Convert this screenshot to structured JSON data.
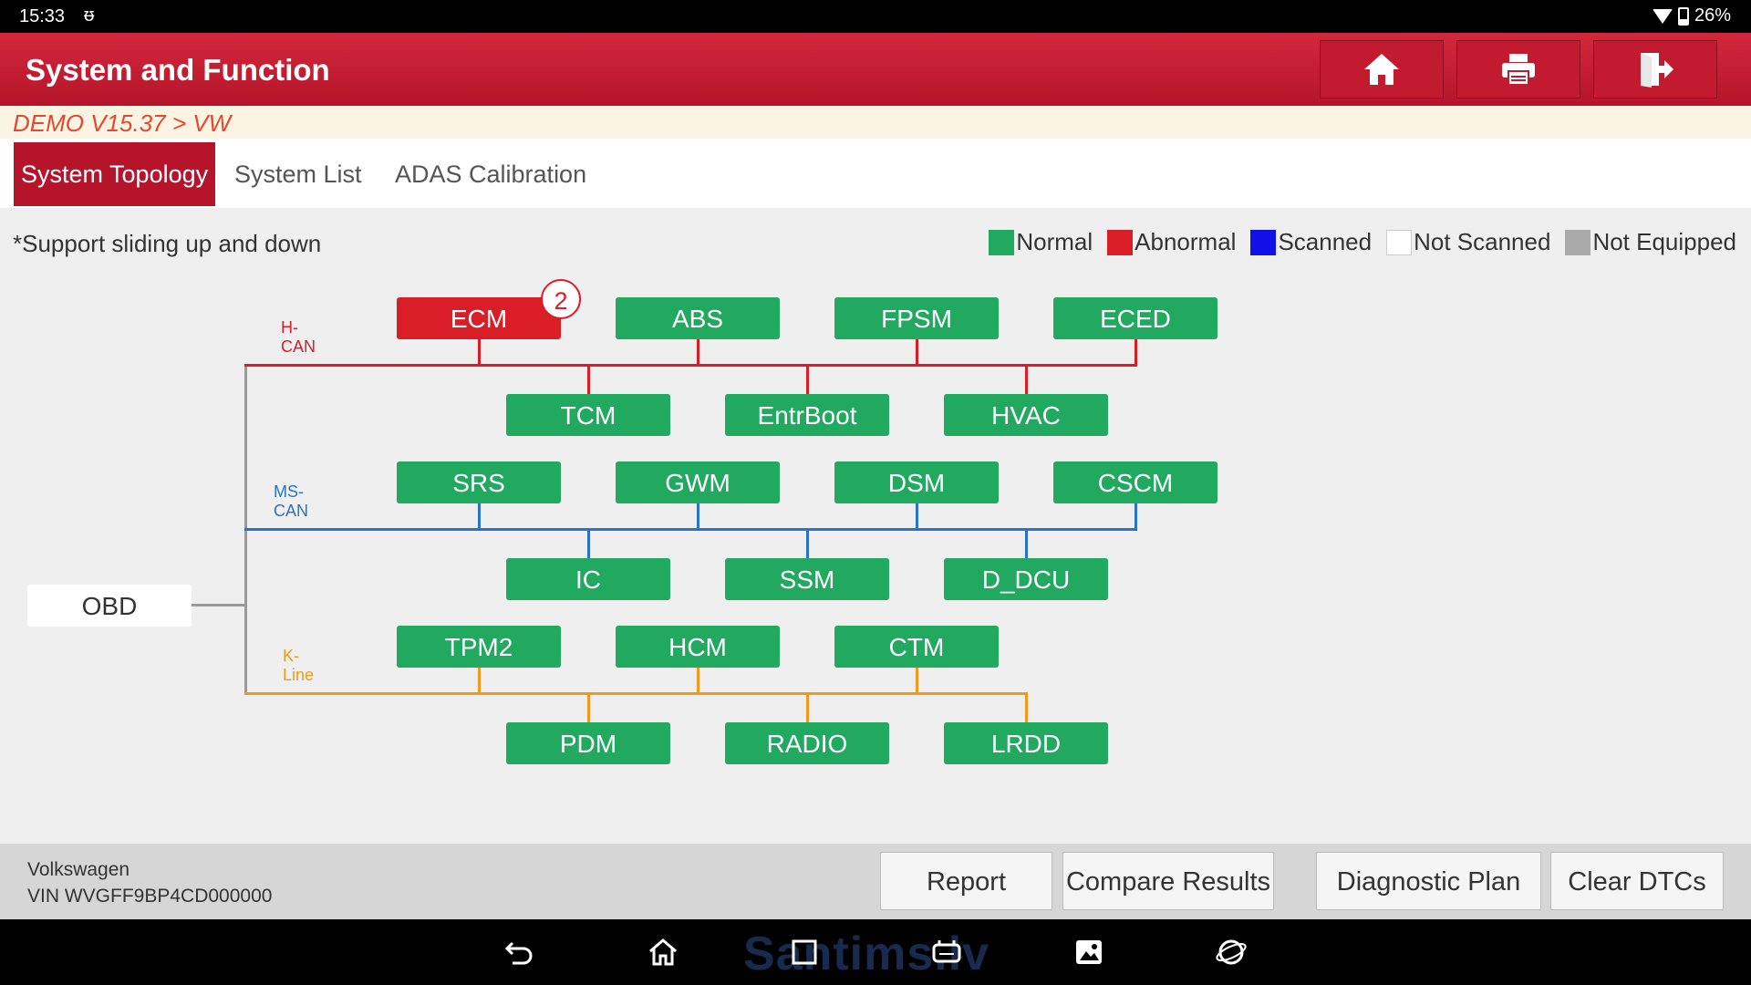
{
  "statusbar": {
    "time": "15:33",
    "battery": "26%"
  },
  "header": {
    "title": "System and Function"
  },
  "breadcrumb": "DEMO V15.37 > VW",
  "tabs": [
    "System Topology",
    "System List",
    "ADAS Calibration"
  ],
  "support_text": "*Support sliding up and down",
  "legend": [
    {
      "label": "Normal",
      "color": "#21a95f"
    },
    {
      "label": "Abnormal",
      "color": "#d91e28"
    },
    {
      "label": "Scanned",
      "color": "#1010e8"
    },
    {
      "label": "Not Scanned",
      "color": "#ffffff"
    },
    {
      "label": "Not Equipped",
      "color": "#aaaaaa"
    }
  ],
  "buses": {
    "hcan": "H-CAN",
    "mscan": "MS-CAN",
    "kline": "K-Line"
  },
  "colors": {
    "hcan": "#d91e28",
    "mscan": "#2b72c6",
    "kline": "#ef9a1a",
    "obd_line": "#999999"
  },
  "obd": "OBD",
  "nodes": {
    "ecm": "ECM",
    "abs": "ABS",
    "fpsm": "FPSM",
    "eced": "ECED",
    "tcm": "TCM",
    "entrboot": "EntrBoot",
    "hvac": "HVAC",
    "srs": "SRS",
    "gwm": "GWM",
    "dsm": "DSM",
    "cscm": "CSCM",
    "ic": "IC",
    "ssm": "SSM",
    "d_dcu": "D_DCU",
    "tpm2": "TPM2",
    "hcm": "HCM",
    "ctm": "CTM",
    "pdm": "PDM",
    "radio": "RADIO",
    "lrdd": "LRDD"
  },
  "ecm_badge": "2",
  "vehicle": {
    "make": "Volkswagen",
    "vin": "VIN WVGFF9BP4CD000000"
  },
  "footer_buttons": {
    "report": "Report",
    "compare": "Compare Results",
    "plan": "Diagnostic Plan",
    "clear": "Clear DTCs"
  },
  "watermark": "Santims.lv"
}
